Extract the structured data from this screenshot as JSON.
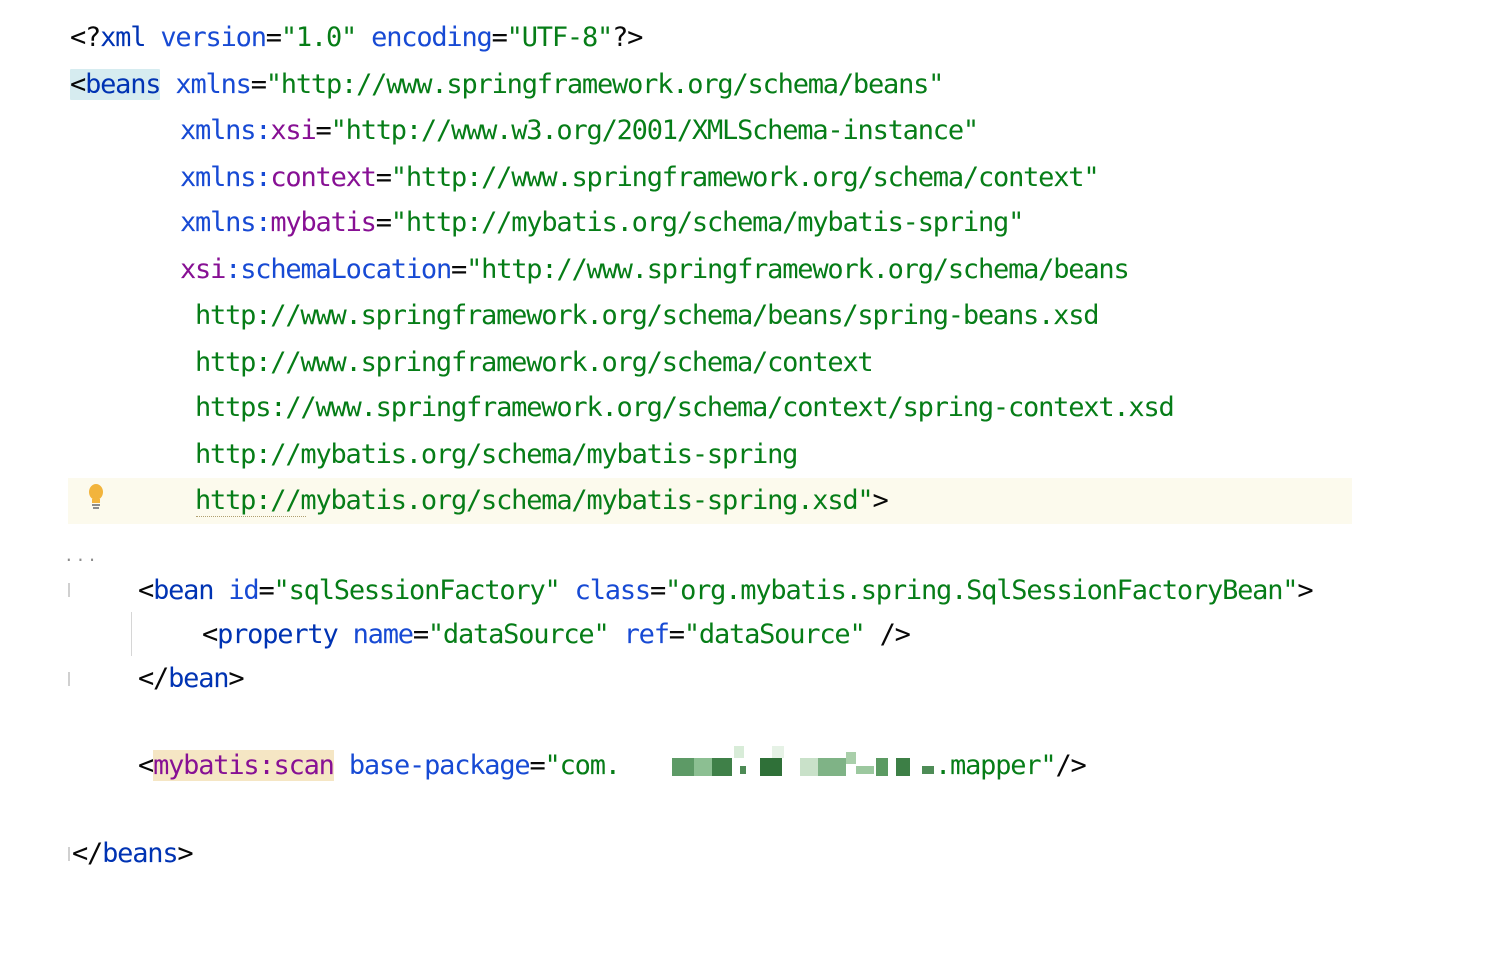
{
  "editor": {
    "file_content_lines": [
      "<?xml version=\"1.0\" encoding=\"UTF-8\"?>",
      "<beans xmlns=\"http://www.springframework.org/schema/beans\"",
      "xmlns:xsi=\"http://www.w3.org/2001/XMLSchema-instance\"",
      "xmlns:context=\"http://www.springframework.org/schema/context\"",
      "xmlns:mybatis=\"http://mybatis.org/schema/mybatis-spring\"",
      "xsi:schemaLocation=\"http://www.springframework.org/schema/beans",
      "http://www.springframework.org/schema/beans/spring-beans.xsd",
      "http://www.springframework.org/schema/context",
      "https://www.springframework.org/schema/context/spring-context.xsd",
      "http://mybatis.org/schema/mybatis-spring",
      "http://mybatis.org/schema/mybatis-spring.xsd\">",
      "...",
      "<bean id=\"sqlSessionFactory\" class=\"org.mybatis.spring.SqlSessionFactoryBean\">",
      "<property name=\"dataSource\" ref=\"dataSource\" />",
      "</bean>",
      "<mybatis:scan base-package=\"com. .mapper\"/>",
      "</beans>"
    ],
    "tokens": {
      "l1": {
        "open": "<?",
        "xml": "xml",
        "a1": "version",
        "eq1": "=",
        "v1": "\"1.0\"",
        "a2": "encoding",
        "eq2": "=",
        "v2": "\"UTF-8\"",
        "close": "?>"
      },
      "l2": {
        "open": "<",
        "tag": "beans",
        "attr": "xmlns",
        "eq": "=",
        "val": "\"http://www.springframework.org/schema/beans\""
      },
      "l3": {
        "pre": "xmlns",
        "colon": ":",
        "ns": "xsi",
        "eq": "=",
        "val": "\"http://www.w3.org/2001/XMLSchema-instance\""
      },
      "l4": {
        "pre": "xmlns",
        "colon": ":",
        "ns": "context",
        "eq": "=",
        "val": "\"http://www.springframework.org/schema/context\""
      },
      "l5": {
        "pre": "xmlns",
        "colon": ":",
        "ns": "mybatis",
        "eq": "=",
        "val": "\"http://mybatis.org/schema/mybatis-spring\""
      },
      "l6": {
        "ns": "xsi",
        "colon": ":",
        "attr": "schemaLocation",
        "eq": "=",
        "val": "\"http://www.springframework.org/schema/beans"
      },
      "l7": {
        "val": "http://www.springframework.org/schema/beans/spring-beans.xsd"
      },
      "l8": {
        "val": "http://www.springframework.org/schema/context"
      },
      "l9": {
        "val": "https://www.springframework.org/schema/context/spring-context.xsd"
      },
      "l10": {
        "val": "http://mybatis.org/schema/mybatis-spring"
      },
      "l11": {
        "val": "http://mybatis.org/schema/mybatis-spring.xsd\"",
        "close": ">"
      },
      "l12": {
        "open": "<",
        "tag": "bean",
        "a1": "id",
        "eq1": "=",
        "v1": "\"sqlSessionFactory\"",
        "a2": "class",
        "eq2": "=",
        "v2": "\"org.mybatis.spring.SqlSessionFactoryBean\"",
        "close": ">"
      },
      "l13": {
        "open": "<",
        "tag": "property",
        "a1": "name",
        "eq1": "=",
        "v1": "\"dataSource\"",
        "a2": "ref",
        "eq2": "=",
        "v2": "\"dataSource\"",
        "close": " />"
      },
      "l14": {
        "open": "</",
        "tag": "bean",
        "close": ">"
      },
      "l15": {
        "open": "<",
        "ns": "mybatis",
        "colon": ":",
        "tag": "scan",
        "attr": "base-package",
        "eq": "=",
        "v_start": "\"com. ",
        "v_end": ".mapper\"",
        "close": "/>"
      },
      "l16": {
        "open": "</",
        "tag": "beans",
        "close": ">"
      }
    },
    "fold_indicator": "...",
    "colors": {
      "tag": "#0033b3",
      "attribute": "#174ad4",
      "namespace": "#871094",
      "value": "#067d17",
      "punctuation": "#080808",
      "caret_line": "#fcfaed",
      "tag_highlight": "#d6ecf0",
      "scan_highlight": "#f5e6c4",
      "bulb": "#f2b43c"
    },
    "icons": [
      "intention-bulb-icon"
    ]
  }
}
